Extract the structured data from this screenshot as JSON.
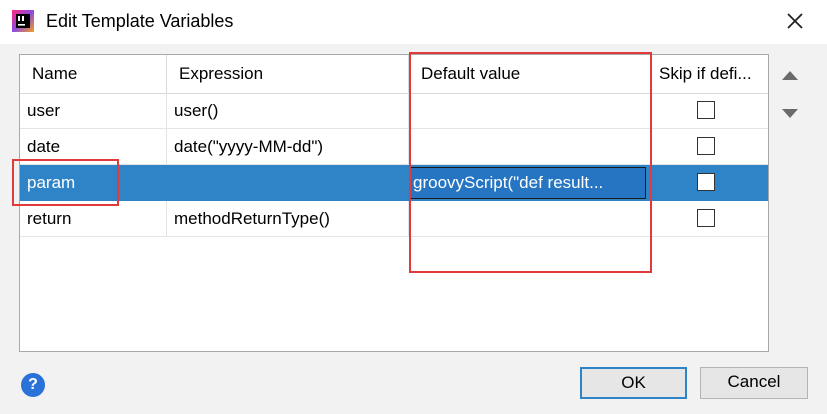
{
  "window": {
    "title": "Edit Template Variables",
    "app_icon": "intellij-icon",
    "close_icon": "close-icon"
  },
  "table": {
    "columns": [
      "Name",
      "Expression",
      "Default value",
      "Skip if defi..."
    ],
    "rows": [
      {
        "name": "user",
        "expression": "user()",
        "default": "",
        "skip": false
      },
      {
        "name": "date",
        "expression": "date(\"yyyy-MM-dd\")",
        "default": "",
        "skip": false
      },
      {
        "name": "param",
        "expression": "",
        "default": "groovyScript(\"def result...",
        "skip": false,
        "selected": true
      },
      {
        "name": "return",
        "expression": "methodReturnType()",
        "default": "",
        "skip": false
      }
    ]
  },
  "scroll": {
    "up_icon": "arrow-up-icon",
    "down_icon": "arrow-down-icon"
  },
  "footer": {
    "help_label": "?",
    "ok_label": "OK",
    "cancel_label": "Cancel"
  },
  "colors": {
    "selection": "#2f84c8",
    "highlight": "#e03a3a",
    "help": "#2b72d8"
  }
}
